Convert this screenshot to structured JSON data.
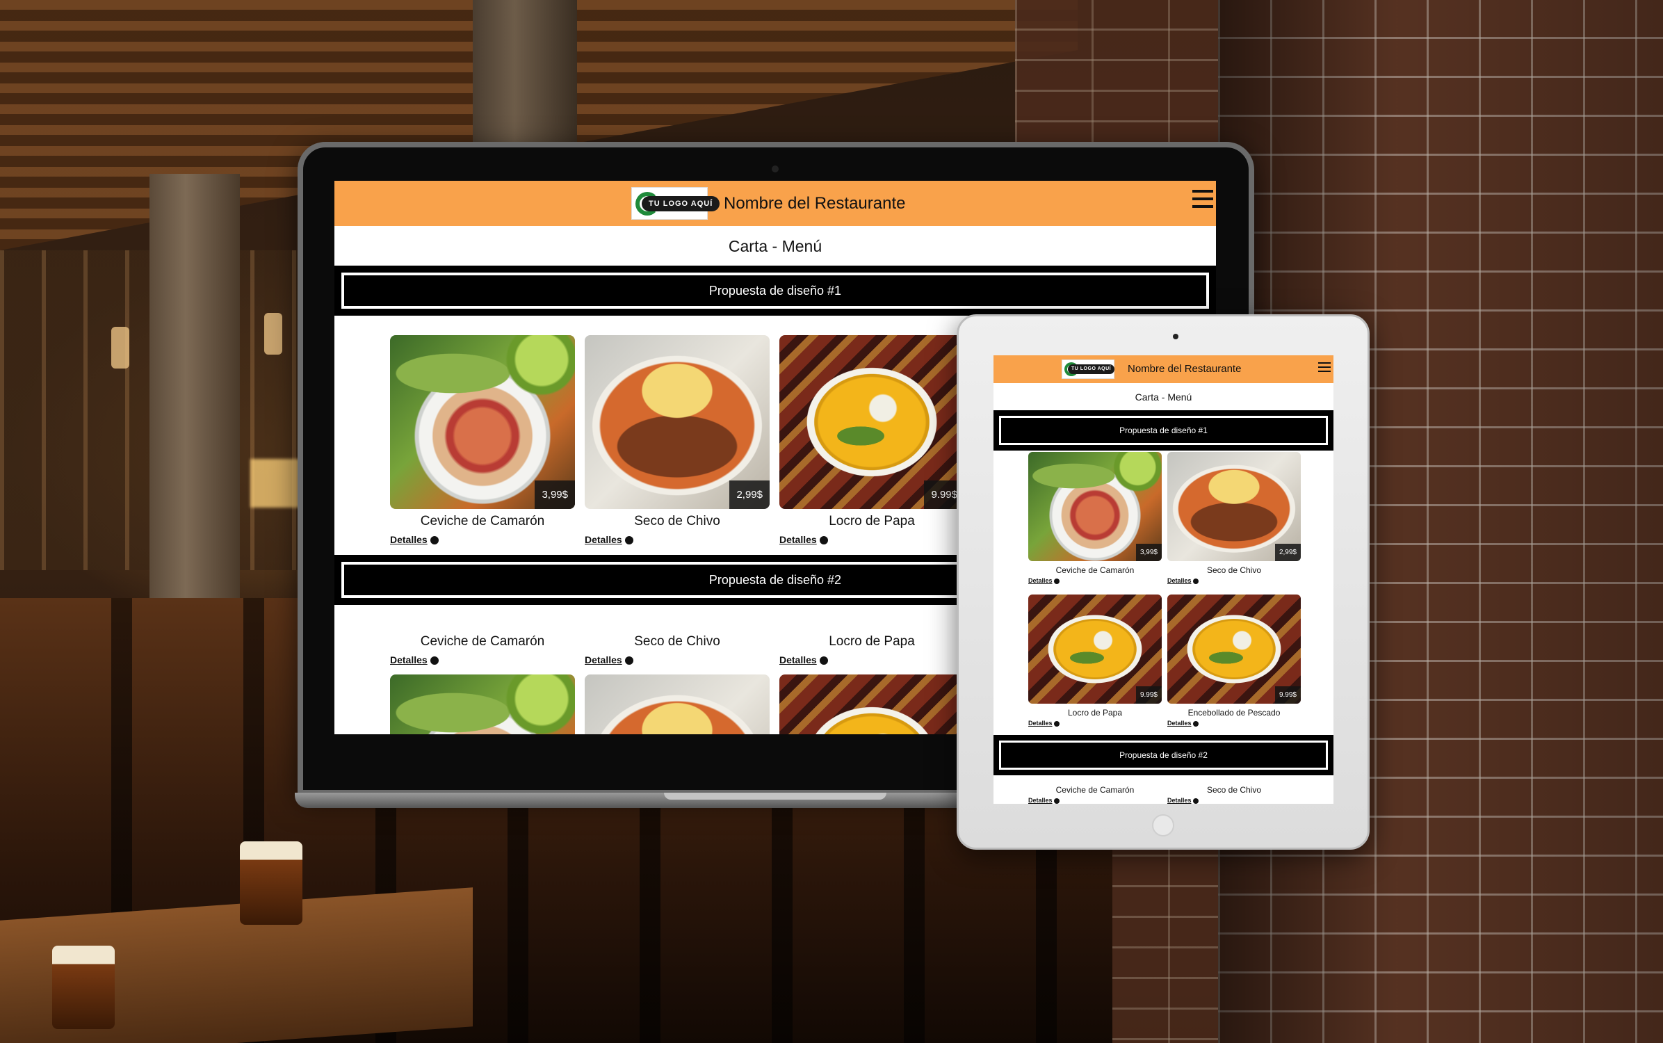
{
  "restaurant": {
    "logo_text": "TU LOGO AQUÍ",
    "name": "Nombre del Restaurante",
    "menu_heading": "Carta - Menú"
  },
  "sections": [
    {
      "title": "Propuesta de diseño #1"
    },
    {
      "title": "Propuesta de diseño #2"
    }
  ],
  "details_label": "Detalles",
  "laptop": {
    "section1_items": [
      {
        "name": "Ceviche de Camarón",
        "price": "3,99$",
        "image": "ceviche-photo"
      },
      {
        "name": "Seco de Chivo",
        "price": "2,99$",
        "image": "seco-photo"
      },
      {
        "name": "Locro de Papa",
        "price": "9.99$",
        "image": "locro-photo"
      }
    ],
    "section2_items": [
      {
        "name": "Ceviche de Camarón",
        "image": "ceviche-photo"
      },
      {
        "name": "Seco de Chivo",
        "image": "seco-photo"
      },
      {
        "name": "Locro de Papa",
        "image": "locro-photo"
      }
    ]
  },
  "tablet": {
    "section1_items": [
      {
        "name": "Ceviche de Camarón",
        "price": "3,99$",
        "image": "ceviche-photo"
      },
      {
        "name": "Seco de Chivo",
        "price": "2,99$",
        "image": "seco-photo"
      },
      {
        "name": "Locro de Papa",
        "price": "9.99$",
        "image": "locro-photo"
      },
      {
        "name": "Encebollado de Pescado",
        "price": "9.99$",
        "image": "locro-photo"
      }
    ],
    "section2_items": [
      {
        "name": "Ceviche de Camarón"
      },
      {
        "name": "Seco de Chivo"
      }
    ]
  },
  "colors": {
    "header": "#f9a24b",
    "section_bar": "#000000",
    "logo_green": "#1f8a3a"
  },
  "icons": {
    "menu": "hamburger-icon",
    "details": "info-circle-icon"
  }
}
